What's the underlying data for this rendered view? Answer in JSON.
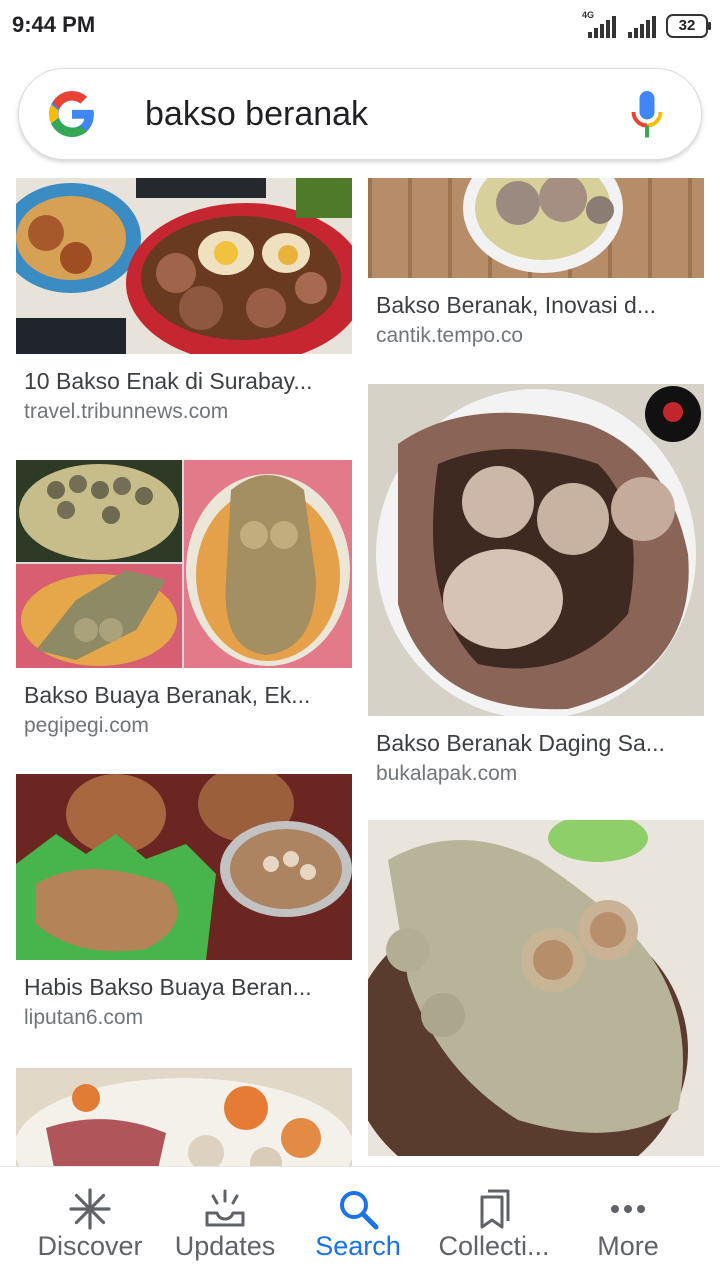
{
  "status_bar": {
    "time": "9:44 PM",
    "network": "4G",
    "battery": "32"
  },
  "search": {
    "query": "bakso beranak"
  },
  "results": [
    {
      "title": "10 Bakso Enak di Surabay...",
      "source": "travel.tribunnews.com"
    },
    {
      "title": "Bakso Beranak, Inovasi d...",
      "source": "cantik.tempo.co"
    },
    {
      "title": "Bakso Buaya Beranak, Ek...",
      "source": "pegipegi.com"
    },
    {
      "title": "Bakso Beranak Daging Sa...",
      "source": "bukalapak.com"
    },
    {
      "title": "Habis Bakso Buaya Beran...",
      "source": "liputan6.com"
    }
  ],
  "bottom_nav": [
    {
      "label": "Discover",
      "icon": "asterisk-icon"
    },
    {
      "label": "Updates",
      "icon": "inbox-icon"
    },
    {
      "label": "Search",
      "icon": "search-icon",
      "active": true
    },
    {
      "label": "Collecti...",
      "icon": "bookmarks-icon"
    },
    {
      "label": "More",
      "icon": "more-dots-icon"
    }
  ],
  "colors": {
    "accent": "#1a73e8",
    "caption": "#3c4043",
    "source": "#70757a"
  }
}
